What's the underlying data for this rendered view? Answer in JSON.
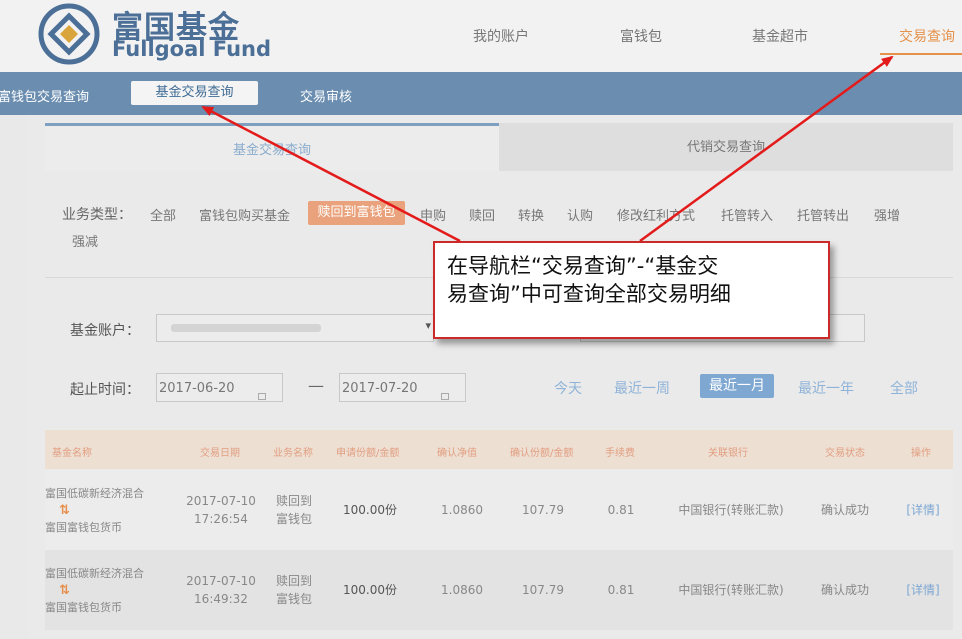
{
  "brand": {
    "name_cn": "富国基金",
    "name_en": "Fullgoal Fund"
  },
  "top_nav": [
    {
      "label": "我的账户"
    },
    {
      "label": "富钱包"
    },
    {
      "label": "基金超市"
    },
    {
      "label": "交易查询",
      "active": true
    }
  ],
  "sub_nav": [
    {
      "label": "富钱包交易查询"
    },
    {
      "label": "基金交易查询",
      "active": true
    },
    {
      "label": "交易审核"
    }
  ],
  "tabs": [
    {
      "label": "基金交易查询",
      "active": true
    },
    {
      "label": "代销交易查询"
    }
  ],
  "filter": {
    "label": "业务类型：",
    "items": [
      "全部",
      "富钱包购买基金",
      "赎回到富钱包",
      "申购",
      "赎回",
      "转换",
      "认购",
      "修改红利方式",
      "托管转入",
      "托管转出",
      "强增",
      "强减"
    ],
    "active_index": 2
  },
  "form": {
    "account_label": "基金账户：",
    "date_label": "起止时间：",
    "start_date": "2017-06-20",
    "end_date": "2017-07-20",
    "dash": "—",
    "quick_ranges": [
      "今天",
      "最近一周",
      "最近一月",
      "最近一年",
      "全部"
    ],
    "quick_active_index": 2
  },
  "table": {
    "headers": [
      "基金名称",
      "交易日期",
      "业务名称",
      "申请份额/金额",
      "确认净值",
      "确认份额/金额",
      "手续费",
      "关联银行",
      "交易状态",
      "操作"
    ],
    "rows": [
      {
        "fund_from": "富国低碳新经济混合",
        "fund_to": "富国富钱包货币",
        "date": "2017-07-10",
        "time": "17:26:54",
        "business_1": "赎回到",
        "business_2": "富钱包",
        "apply_amount": "100.00份",
        "nav": "1.0860",
        "confirm_amount": "107.79",
        "fee": "0.81",
        "bank": "中国银行(转账汇款)",
        "status": "确认成功",
        "action": "[详情]"
      },
      {
        "fund_from": "富国低碳新经济混合",
        "fund_to": "富国富钱包货币",
        "date": "2017-07-10",
        "time": "16:49:32",
        "business_1": "赎回到",
        "business_2": "富钱包",
        "apply_amount": "100.00份",
        "nav": "1.0860",
        "confirm_amount": "107.79",
        "fee": "0.81",
        "bank": "中国银行(转账汇款)",
        "status": "确认成功",
        "action": "[详情]"
      }
    ]
  },
  "callout": {
    "line1": "在导航栏“交易查询”-“基金交",
    "line2": "易查询”中可查询全部交易明细"
  },
  "colors": {
    "brand": "#4b6f96",
    "accent": "#e5924b",
    "annotation": "#e31b1b"
  }
}
